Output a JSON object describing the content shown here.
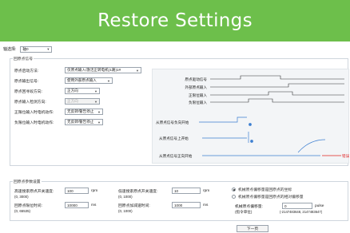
{
  "banner": {
    "title": "Restore Settings"
  },
  "axis_select": {
    "label": "轴选择:",
    "value": "轴0"
  },
  "homing_signal": {
    "group_title": "回原点信号",
    "fields": [
      {
        "label": "原点启动方法:",
        "value": "仅原点输入/激活正转电机(1路)1#",
        "disabled": false
      },
      {
        "label": "原点输出信号:",
        "value": "使用外部原点输入",
        "disabled": false
      },
      {
        "label": "原点回寻段方向:",
        "value": "正方向",
        "disabled": false
      },
      {
        "label": "原点输入检测方向:",
        "value": "正方向",
        "disabled": true
      },
      {
        "label": "正限位输入时电机动作:",
        "value": "无反转/警告停止",
        "disabled": false
      },
      {
        "label": "负限位输入时电机动作:",
        "value": "无反转/警告停止",
        "disabled": false
      }
    ]
  },
  "diagram": {
    "signals": [
      "原点驱动信号",
      "外部原点输入",
      "正限位输入",
      "负限位输入"
    ],
    "scenarios": [
      "从原点信号负向开始",
      "从原点信号上开始",
      "从原点信号正向开始"
    ],
    "error_label": "错误",
    "colors": {
      "scenario_line": "#3d7fd1",
      "error": "#e02020",
      "signal": "#333333"
    }
  },
  "homing_params": {
    "group_title": "回原点参数设置",
    "fields": [
      {
        "label": "高速搜索原点开关速度:",
        "value": "100",
        "unit": "rpm",
        "range": "(0, 3000)"
      },
      {
        "label": "低速搜索原点开关速度:",
        "value": "10",
        "unit": "rpm",
        "range": "(0, 1000)"
      },
      {
        "label": "回原点限位时间:",
        "value": "10000",
        "unit": "ms",
        "range": "(0, 65535)"
      },
      {
        "label": "回原点加减速时间:",
        "value": "1000",
        "unit": "ms",
        "range": "(0, 1000)"
      }
    ]
  },
  "offset": {
    "options": [
      "机械原点偏移量是回原点的坐标",
      "机械原点偏移量是回原点的相对偏移量"
    ],
    "selected": 0,
    "label": "机械原点偏移量:",
    "sub_label": "(指令单位)",
    "value": "0",
    "unit": "pulse",
    "range": "(-2147483648, 2147483647)"
  },
  "footer": {
    "next_label": "下一页"
  }
}
